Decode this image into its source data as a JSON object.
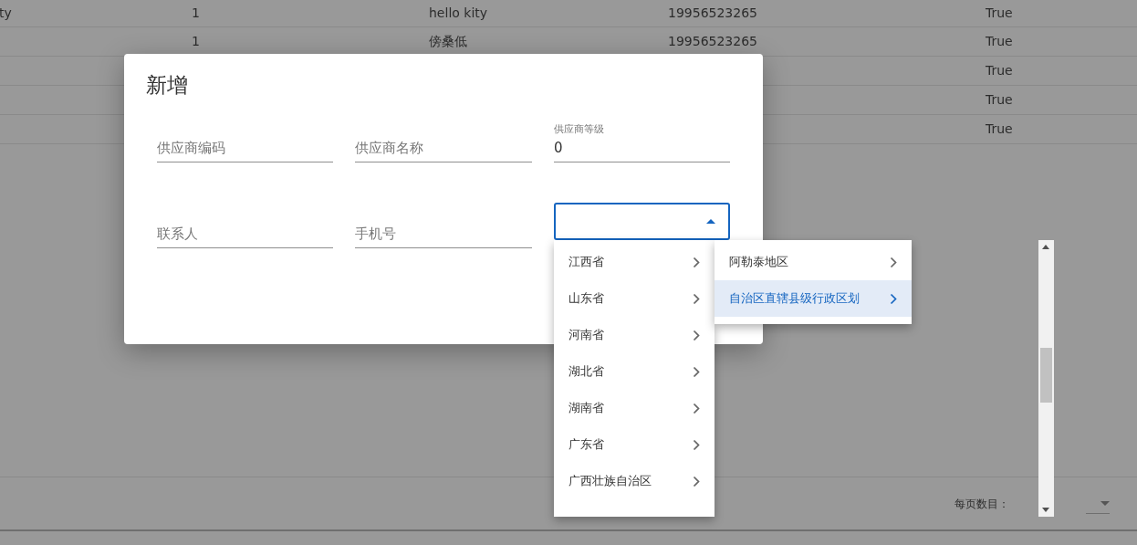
{
  "table": {
    "rows": [
      {
        "cells": [
          "ty",
          "1",
          "hello kity",
          "19956523265",
          "True"
        ]
      },
      {
        "cells": [
          null,
          "1",
          "傍桑低",
          "19956523265",
          "True"
        ]
      },
      {
        "cells": [
          null,
          null,
          null,
          null,
          "True"
        ]
      },
      {
        "cells": [
          null,
          null,
          null,
          null,
          "True"
        ]
      },
      {
        "cells": [
          null,
          null,
          null,
          null,
          "True"
        ]
      }
    ]
  },
  "pagination": {
    "label": "每页数目："
  },
  "dialog": {
    "title": "新增",
    "fields": [
      {
        "kind": "text",
        "placeholder": "供应商编码"
      },
      {
        "kind": "text",
        "placeholder": "供应商名称"
      },
      {
        "kind": "number",
        "label": "供应商等级",
        "value": "0"
      },
      {
        "kind": "text",
        "placeholder": "联系人"
      },
      {
        "kind": "text",
        "placeholder": "手机号"
      },
      {
        "kind": "select",
        "focused": true
      }
    ]
  },
  "cascader": {
    "columns": [
      {
        "items": [
          {
            "label": "江西省",
            "selected": false
          },
          {
            "label": "山东省",
            "selected": false
          },
          {
            "label": "河南省",
            "selected": false
          },
          {
            "label": "湖北省",
            "selected": false
          },
          {
            "label": "湖南省",
            "selected": false
          },
          {
            "label": "广东省",
            "selected": false
          },
          {
            "label": "广西壮族自治区",
            "selected": false
          }
        ]
      },
      {
        "items": [
          {
            "label": "阿勒泰地区",
            "selected": false
          },
          {
            "label": "自治区直辖县级行政区划",
            "selected": true
          }
        ]
      }
    ]
  }
}
